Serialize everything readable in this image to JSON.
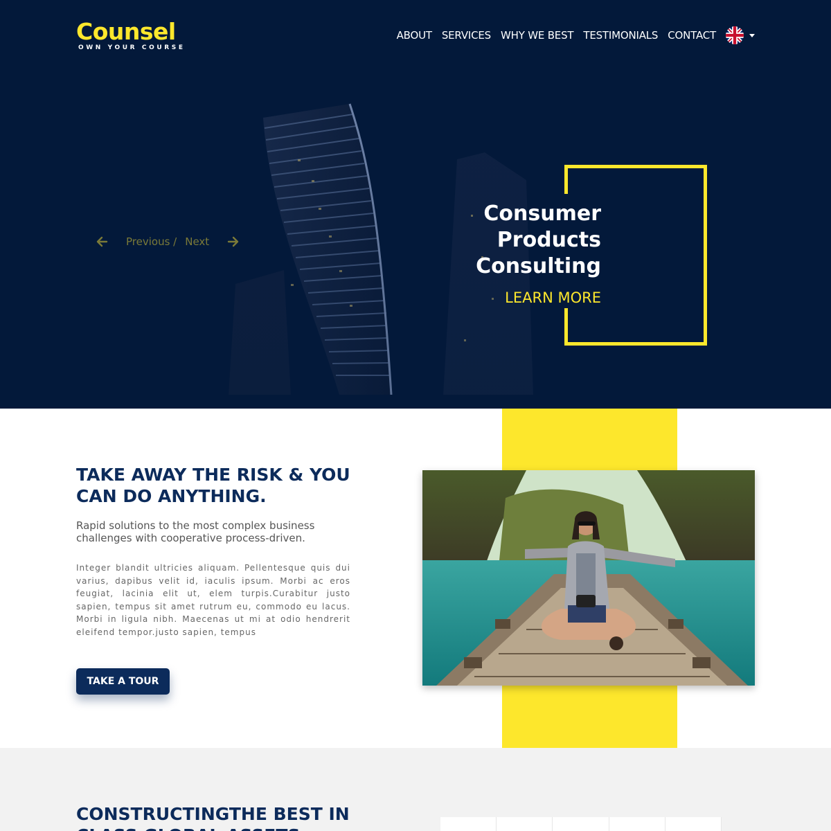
{
  "brand": {
    "name": "Counsel",
    "tagline": "OWN YOUR COURSE",
    "accent": "#fde72c",
    "navy": "#03193a",
    "heading_color": "#0c2b5b"
  },
  "nav": {
    "items": [
      "ABOUT",
      "SERVICES",
      "WHY WE BEST",
      "TESTIMONIALS",
      "CONTACT"
    ],
    "language_icon": "uk-flag-icon"
  },
  "hero": {
    "prev_label": "Previous /",
    "next_label": "Next",
    "slide_title_lines": [
      "Consumer",
      "Products",
      "Consulting"
    ],
    "cta": "LEARN MORE"
  },
  "about": {
    "title": "TAKE AWAY THE RISK & YOU CAN DO ANYTHING.",
    "subtitle": "Rapid solutions to the most complex business challenges with cooperative process-driven.",
    "body": "Integer blandit ultricies aliquam. Pellentesque quis dui varius, dapibus velit id, iaculis ipsum. Morbi ac eros feugiat, lacinia elit ut, elem turpis.Curabitur justo sapien, tempus sit amet rutrum eu, commodo eu lacus. Morbi in ligula nibh. Maecenas ut mi at odio hendrerit eleifend tempor.justo sapien, tempus",
    "button": "TAKE A TOUR"
  },
  "assets": {
    "title": "CONSTRUCTINGTHE BEST IN CLASS GLOBAL ASSETS"
  }
}
